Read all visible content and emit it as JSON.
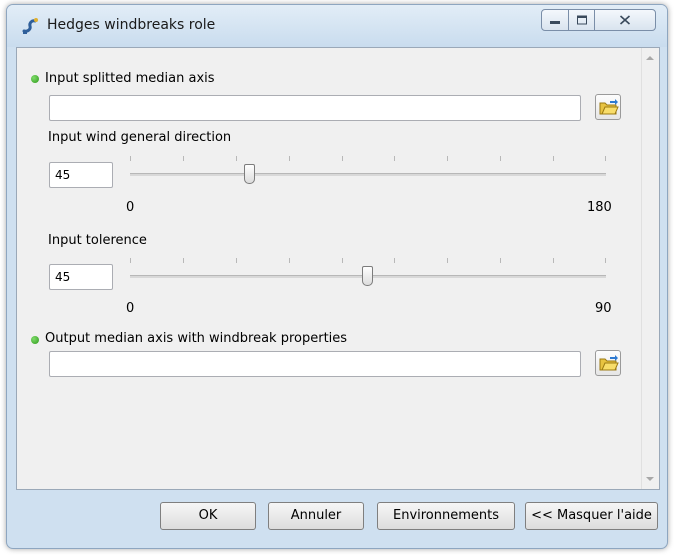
{
  "window": {
    "title": "Hedges windbreaks role",
    "icons": {
      "app": "python-script-icon",
      "minimize": "minimize-icon",
      "maximize": "maximize-icon",
      "close": "close-icon"
    }
  },
  "form": {
    "input_axis": {
      "label": "Input splitted median axis",
      "value": ""
    },
    "wind_direction": {
      "label": "Input wind general direction",
      "value": "45",
      "min": "0",
      "max": "180"
    },
    "tolerance": {
      "label": "Input tolerence",
      "value": "45",
      "min": "0",
      "max": "90"
    },
    "output_axis": {
      "label": "Output median axis with windbreak properties",
      "value": ""
    }
  },
  "buttons": {
    "ok": "OK",
    "cancel": "Annuler",
    "environments": "Environnements",
    "hide_help": "<< Masquer l'aide"
  },
  "colors": {
    "required_bullet": "#2e9a1c",
    "titlebar": "#cfe0f0"
  }
}
